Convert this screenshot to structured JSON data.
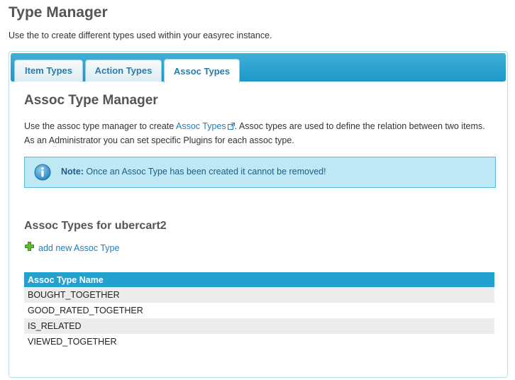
{
  "page": {
    "title": "Type Manager",
    "description": "Use the to create different types used within your easyrec instance."
  },
  "tabs": [
    {
      "label": "Item Types",
      "active": false
    },
    {
      "label": "Action Types",
      "active": false
    },
    {
      "label": "Assoc Types",
      "active": true
    }
  ],
  "section": {
    "title": "Assoc Type Manager",
    "intro_before_link": "Use the assoc type manager to create ",
    "intro_link": "Assoc Types",
    "intro_after_link": ". Assoc types are used to define the relation between two items. As an Administrator you can set specific Plugins for each assoc type."
  },
  "note": {
    "label": "Note:",
    "text": " Once an Assoc Type has been created it cannot be removed!",
    "icon": "info-icon"
  },
  "list": {
    "title": "Assoc Types for ubercart2",
    "add_label": "add new Assoc Type",
    "add_icon": "plus-icon",
    "column_header": "Assoc Type Name",
    "rows": [
      "BOUGHT_TOGETHER",
      "GOOD_RATED_TOGETHER",
      "IS_RELATED",
      "VIEWED_TOGETHER"
    ]
  },
  "colors": {
    "accent": "#23a2d0",
    "link": "#1a7fc0",
    "note_bg": "#bfe8f5"
  }
}
